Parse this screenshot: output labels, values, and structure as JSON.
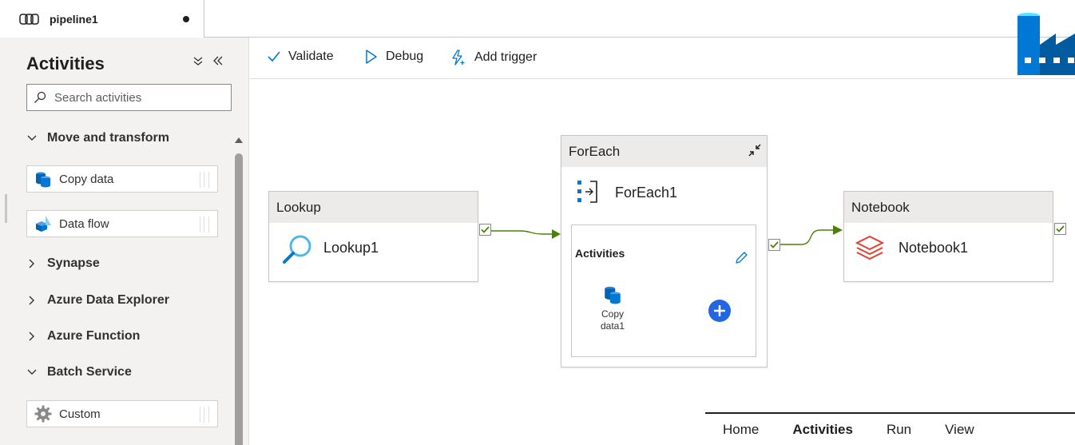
{
  "tab": {
    "title": "pipeline1"
  },
  "sidebar": {
    "title": "Activities",
    "search_placeholder": "Search activities",
    "categories": [
      {
        "label": "Move and transform",
        "expanded": true,
        "items": [
          {
            "label": "Copy data",
            "icon": "copy-data-icon"
          },
          {
            "label": "Data flow",
            "icon": "data-flow-icon"
          }
        ]
      },
      {
        "label": "Synapse",
        "expanded": false
      },
      {
        "label": "Azure Data Explorer",
        "expanded": false
      },
      {
        "label": "Azure Function",
        "expanded": false
      },
      {
        "label": "Batch Service",
        "expanded": true,
        "items": [
          {
            "label": "Custom",
            "icon": "gear-icon"
          }
        ]
      }
    ]
  },
  "toolbar": {
    "validate_label": "Validate",
    "debug_label": "Debug",
    "add_trigger_label": "Add trigger"
  },
  "canvas": {
    "lookup": {
      "type": "Lookup",
      "name": "Lookup1"
    },
    "foreach": {
      "type": "ForEach",
      "name": "ForEach1",
      "inner_title": "Activities",
      "inner_activity": "Copy data1"
    },
    "notebook": {
      "type": "Notebook",
      "name": "Notebook1"
    }
  },
  "bottom_menu": {
    "items": [
      "Home",
      "Activities",
      "Run",
      "View"
    ],
    "active": "Activities"
  },
  "colors": {
    "success_green": "#498205",
    "azure_blue": "#0078d4",
    "databricks_red": "#e0402f",
    "pane_bg": "#f3f2f1",
    "node_header": "#edebe9"
  }
}
